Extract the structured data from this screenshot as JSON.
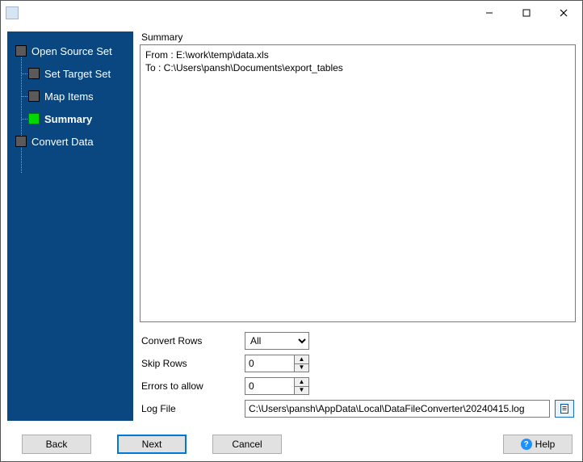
{
  "sidebar": {
    "items": [
      {
        "label": "Open Source Set"
      },
      {
        "label": "Set Target Set"
      },
      {
        "label": "Map Items"
      },
      {
        "label": "Summary"
      },
      {
        "label": "Convert Data"
      }
    ]
  },
  "main": {
    "title": "Summary",
    "summary_text": "From : E:\\work\\temp\\data.xls\nTo : C:\\Users\\pansh\\Documents\\export_tables",
    "convert_rows_label": "Convert Rows",
    "convert_rows_value": "All",
    "skip_rows_label": "Skip Rows",
    "skip_rows_value": "0",
    "errors_label": "Errors to allow",
    "errors_value": "0",
    "logfile_label": "Log File",
    "logfile_value": "C:\\Users\\pansh\\AppData\\Local\\DataFileConverter\\20240415.log"
  },
  "footer": {
    "back": "Back",
    "next": "Next",
    "cancel": "Cancel",
    "help": "Help"
  }
}
